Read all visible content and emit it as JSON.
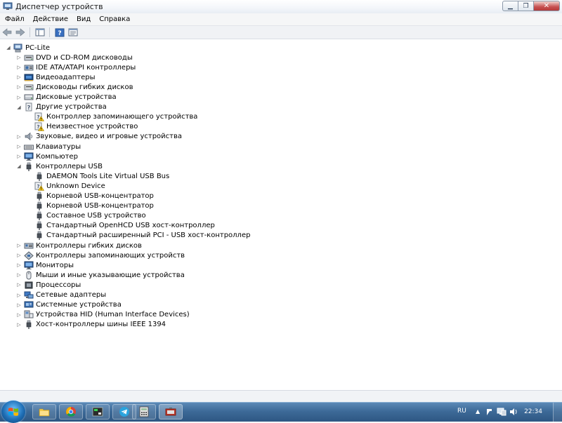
{
  "window": {
    "title": "Диспетчер устройств"
  },
  "menu": [
    "Файл",
    "Действие",
    "Вид",
    "Справка"
  ],
  "tree": [
    {
      "label": "PC-Lite",
      "level": 0,
      "exp": "open",
      "icon": "computer-icon"
    },
    {
      "label": "DVD и CD-ROM дисководы",
      "level": 1,
      "exp": "closed",
      "icon": "optical-drive-icon"
    },
    {
      "label": "IDE ATA/ATAPI контроллеры",
      "level": 1,
      "exp": "closed",
      "icon": "ide-controller-icon"
    },
    {
      "label": "Видеоадаптеры",
      "level": 1,
      "exp": "closed",
      "icon": "display-adapter-icon"
    },
    {
      "label": "Дисководы гибких дисков",
      "level": 1,
      "exp": "closed",
      "icon": "floppy-drive-icon"
    },
    {
      "label": "Дисковые устройства",
      "level": 1,
      "exp": "closed",
      "icon": "disk-drive-icon"
    },
    {
      "label": "Другие устройства",
      "level": 1,
      "exp": "open",
      "icon": "unknown-device-icon"
    },
    {
      "label": "Контроллер запоминающего устройства",
      "level": 2,
      "exp": "none",
      "icon": "warning-device-icon"
    },
    {
      "label": "Неизвестное устройство",
      "level": 2,
      "exp": "none",
      "icon": "warning-device-icon"
    },
    {
      "label": "Звуковые, видео и игровые устройства",
      "level": 1,
      "exp": "closed",
      "icon": "speaker-icon"
    },
    {
      "label": "Клавиатуры",
      "level": 1,
      "exp": "closed",
      "icon": "keyboard-icon"
    },
    {
      "label": "Компьютер",
      "level": 1,
      "exp": "closed",
      "icon": "monitor-icon"
    },
    {
      "label": "Контроллеры USB",
      "level": 1,
      "exp": "open",
      "icon": "usb-plug-icon"
    },
    {
      "label": "DAEMON Tools Lite Virtual USB Bus",
      "level": 2,
      "exp": "none",
      "icon": "usb-plug-icon"
    },
    {
      "label": "Unknown Device",
      "level": 2,
      "exp": "none",
      "icon": "warning-device-icon"
    },
    {
      "label": "Корневой USB-концентратор",
      "level": 2,
      "exp": "none",
      "icon": "usb-plug-icon"
    },
    {
      "label": "Корневой USB-концентратор",
      "level": 2,
      "exp": "none",
      "icon": "usb-plug-icon"
    },
    {
      "label": "Составное USB устройство",
      "level": 2,
      "exp": "none",
      "icon": "usb-plug-icon"
    },
    {
      "label": "Стандартный OpenHCD USB хост-контроллер",
      "level": 2,
      "exp": "none",
      "icon": "usb-plug-icon"
    },
    {
      "label": "Стандартный расширенный PCI - USB хост-контроллер",
      "level": 2,
      "exp": "none",
      "icon": "usb-plug-icon"
    },
    {
      "label": "Контроллеры гибких дисков",
      "level": 1,
      "exp": "closed",
      "icon": "floppy-controller-icon"
    },
    {
      "label": "Контроллеры запоминающих устройств",
      "level": 1,
      "exp": "closed",
      "icon": "storage-controller-icon"
    },
    {
      "label": "Мониторы",
      "level": 1,
      "exp": "closed",
      "icon": "monitor-icon"
    },
    {
      "label": "Мыши и иные указывающие устройства",
      "level": 1,
      "exp": "closed",
      "icon": "mouse-icon"
    },
    {
      "label": "Процессоры",
      "level": 1,
      "exp": "closed",
      "icon": "processor-icon"
    },
    {
      "label": "Сетевые адаптеры",
      "level": 1,
      "exp": "closed",
      "icon": "network-adapter-icon"
    },
    {
      "label": "Системные устройства",
      "level": 1,
      "exp": "closed",
      "icon": "system-device-icon"
    },
    {
      "label": "Устройства HID (Human Interface Devices)",
      "level": 1,
      "exp": "closed",
      "icon": "hid-icon"
    },
    {
      "label": "Хост-контроллеры шины IEEE 1394",
      "level": 1,
      "exp": "closed",
      "icon": "ieee1394-icon"
    }
  ],
  "taskbar": {
    "language": "RU",
    "clock": "22:34"
  }
}
